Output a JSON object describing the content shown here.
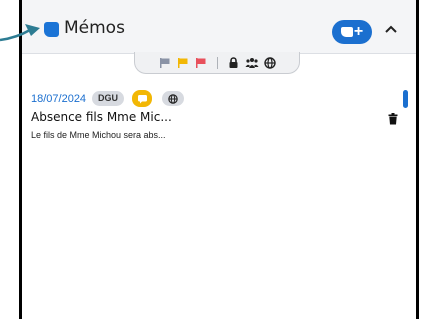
{
  "panel": {
    "title": "Mémos",
    "add_button_plus": "+",
    "icons": {
      "title": "memo-icon",
      "add": "add-memo-icon",
      "collapse": "chevron-up-icon",
      "pointer": "arrow-right-icon"
    }
  },
  "filters": {
    "items": [
      {
        "name": "flag-grey",
        "color": "#8a93a6"
      },
      {
        "name": "flag-yellow",
        "color": "#f2b705"
      },
      {
        "name": "flag-red",
        "color": "#e8505b"
      },
      {
        "name": "lock",
        "color": "#222222"
      },
      {
        "name": "group",
        "color": "#222222"
      },
      {
        "name": "globe",
        "color": "#222222"
      }
    ]
  },
  "memo": {
    "date": "18/07/2024",
    "author": "DGU",
    "title": "Absence fils Mme Mic...",
    "preview": "Le fils de Mme Michou sera abs...",
    "icons": {
      "category": "chat-icon",
      "visibility": "globe-icon",
      "delete": "trash-icon"
    }
  },
  "colors": {
    "accent": "#1b6fcf",
    "header_bg": "#f4f5f7",
    "arrow": "#2d7c93",
    "badge_yellow": "#f2b705"
  }
}
